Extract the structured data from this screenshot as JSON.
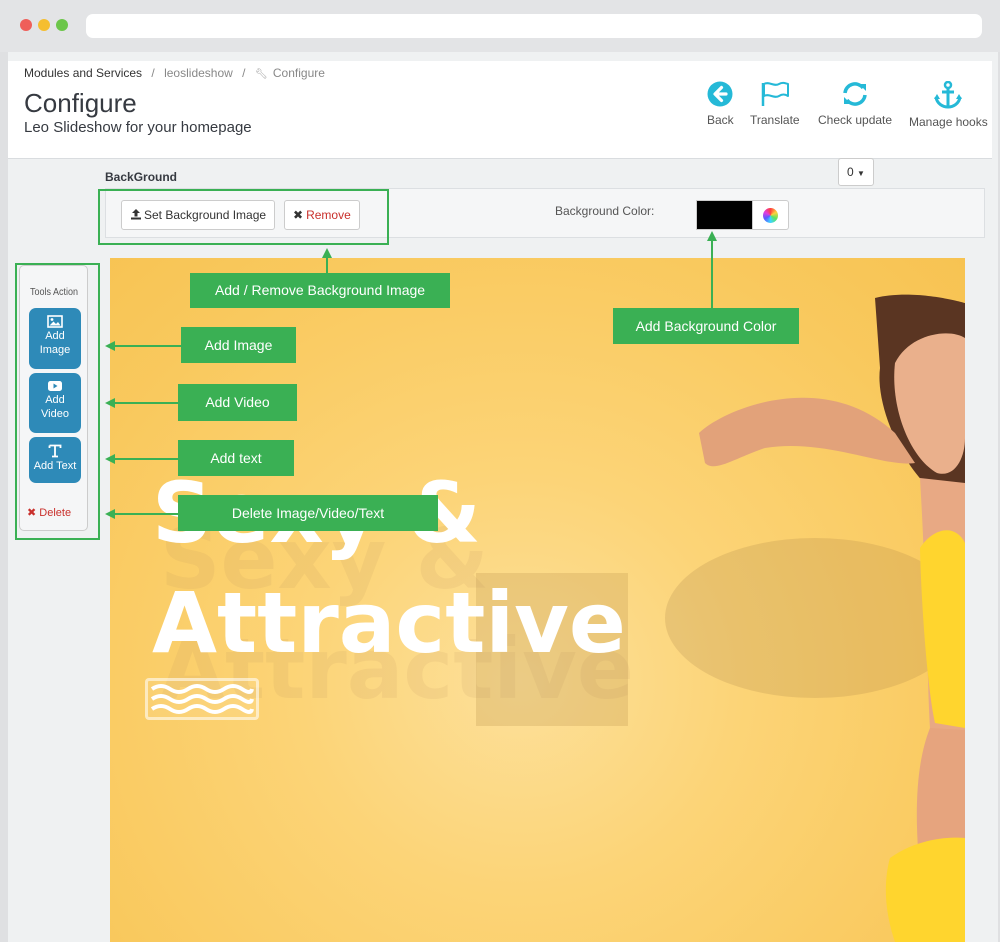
{
  "header": {
    "breadcrumb": [
      "Modules and Services",
      "leoslideshow",
      "Configure"
    ],
    "title": "Configure",
    "subtitle": "Leo Slideshow for your homepage"
  },
  "toolbar": {
    "back_label": "Back",
    "translate_label": "Translate",
    "check_update_label": "Check update",
    "manage_hooks_label": "Manage hooks",
    "icon_color": "#25b9d7"
  },
  "background_section": {
    "title": "BackGround",
    "dropdown_value": "0",
    "set_image_label": "Set Background Image",
    "remove_label": "Remove",
    "color_label": "Background Color:",
    "color_value": "#000000"
  },
  "tools": {
    "title": "Tools Action",
    "add_image_label": "Add Image",
    "add_video_label": "Add Video",
    "add_text_label": "Add Text",
    "delete_label": "Delete"
  },
  "slide": {
    "line1": "Sexy &",
    "line2": "Attractive"
  },
  "callouts": {
    "add_remove_bg": "Add / Remove Background Image",
    "add_bg_color": "Add Background Color",
    "add_image": "Add Image",
    "add_video": "Add Video",
    "add_text": "Add text",
    "delete": "Delete Image/Video/Text",
    "color": "#3ab054"
  }
}
